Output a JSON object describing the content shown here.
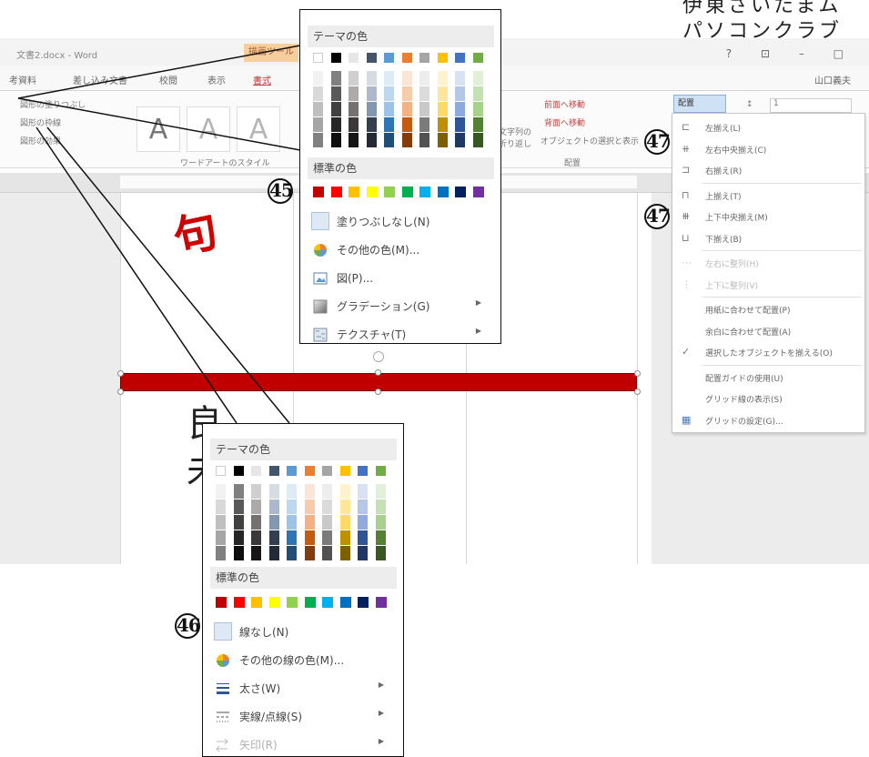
{
  "window": {
    "title": "文書2.docx - Word",
    "context_tab": "描画ツール",
    "controls": "? ⊡ – □"
  },
  "club_label": {
    "line1": "伊東さいたまム",
    "line2": "パソコンクラブ"
  },
  "tabs": [
    "考資料",
    "差し込み文書",
    "校閲",
    "表示",
    "書式"
  ],
  "user": "山口義夫",
  "ribbon": {
    "shape_fill": "図形の塗りつぶし",
    "shape_outline": "図形の枠線",
    "shape_effects": "図形の効果",
    "wordart_group": "ワードアートのスタイル",
    "wordart_letters": [
      "A",
      "A",
      "A"
    ],
    "bring_forward": "前面へ移動",
    "send_backward": "背面へ移動",
    "selection_pane": "オブジェクトの選択と表示",
    "wrap_text": "文字列の折り返し",
    "arrange_group": "配置",
    "align_button": "配置",
    "height_label": "↕",
    "height_value": "1"
  },
  "doc_text": {
    "top_kanji": "句",
    "side_kanji": "良未"
  },
  "fill_popup": {
    "theme_header": "テーマの色",
    "standard_header": "標準の色",
    "items": [
      {
        "icon": "no-fill-icon",
        "label": "塗りつぶしなし(N)"
      },
      {
        "icon": "color-wheel-icon",
        "label": "その他の色(M)..."
      },
      {
        "icon": "picture-icon",
        "label": "図(P)..."
      },
      {
        "icon": "gradient-icon",
        "label": "グラデーション(G)",
        "submenu": true
      },
      {
        "icon": "texture-icon",
        "label": "テクスチャ(T)",
        "submenu": true
      }
    ]
  },
  "outline_popup": {
    "theme_header": "テーマの色",
    "standard_header": "標準の色",
    "items": [
      {
        "icon": "no-outline-icon",
        "label": "線なし(N)"
      },
      {
        "icon": "color-wheel-icon",
        "label": "その他の線の色(M)..."
      },
      {
        "icon": "line-weight-icon",
        "label": "太さ(W)",
        "submenu": true
      },
      {
        "icon": "dash-icon",
        "label": "実線/点線(S)",
        "submenu": true
      },
      {
        "icon": "arrow-icon",
        "label": "矢印(R)",
        "submenu": true,
        "disabled": true
      }
    ]
  },
  "theme_colors": {
    "top": [
      "#ffffff",
      "#000000",
      "#e7e6e6",
      "#44546a",
      "#5b9bd5",
      "#ed7d31",
      "#a5a5a5",
      "#ffc000",
      "#4472c4",
      "#70ad47"
    ],
    "columns": [
      [
        "#f2f2f2",
        "#d9d9d9",
        "#bfbfbf",
        "#a6a6a6",
        "#808080"
      ],
      [
        "#808080",
        "#595959",
        "#404040",
        "#262626",
        "#0d0d0d"
      ],
      [
        "#d0cece",
        "#aeaaaa",
        "#757171",
        "#3a3838",
        "#171616"
      ],
      [
        "#d6dce4",
        "#acb9ca",
        "#8497b0",
        "#333f4f",
        "#222a35"
      ],
      [
        "#ddebf7",
        "#bdd7ee",
        "#9dc3e6",
        "#2e75b6",
        "#1f4e79"
      ],
      [
        "#fbe5d6",
        "#f8cbad",
        "#f4b183",
        "#c55a11",
        "#843c0c"
      ],
      [
        "#ededed",
        "#dbdbdb",
        "#c9c9c9",
        "#7b7b7b",
        "#525252"
      ],
      [
        "#fff2cc",
        "#ffe699",
        "#ffd966",
        "#bf9000",
        "#7f6000"
      ],
      [
        "#d9e2f3",
        "#b4c7e7",
        "#8faadc",
        "#2f5597",
        "#203864"
      ],
      [
        "#e2f0d9",
        "#c5e0b4",
        "#a9d18e",
        "#548235",
        "#385723"
      ]
    ]
  },
  "standard_colors": [
    "#c00000",
    "#ff0000",
    "#ffc000",
    "#ffff00",
    "#92d050",
    "#00b050",
    "#00b0f0",
    "#0070c0",
    "#002060",
    "#7030a0"
  ],
  "align_menu": {
    "items": [
      {
        "icon": "align-left-icon",
        "label": "左揃え(L)"
      },
      {
        "icon": "align-center-icon",
        "label": "左右中央揃え(C)"
      },
      {
        "icon": "align-right-icon",
        "label": "右揃え(R)"
      },
      {
        "icon": "align-top-icon",
        "label": "上揃え(T)"
      },
      {
        "icon": "align-middle-icon",
        "label": "上下中央揃え(M)"
      },
      {
        "icon": "align-bottom-icon",
        "label": "下揃え(B)"
      },
      {
        "icon": "distribute-h-icon",
        "label": "左右に整列(H)",
        "disabled": true
      },
      {
        "icon": "distribute-v-icon",
        "label": "上下に整列(V)",
        "disabled": true
      },
      {
        "icon": "",
        "label": "用紙に合わせて配置(P)"
      },
      {
        "icon": "",
        "label": "余白に合わせて配置(A)"
      },
      {
        "icon": "check-icon",
        "label": "選択したオブジェクトを揃える(O)"
      },
      {
        "icon": "",
        "label": "配置ガイドの使用(U)"
      },
      {
        "icon": "",
        "label": "グリッド線の表示(S)"
      },
      {
        "icon": "grid-settings-icon",
        "label": "グリッドの設定(G)..."
      }
    ]
  },
  "markers": {
    "m45": "45",
    "m46": "46",
    "m47a": "47",
    "m47b": "47"
  }
}
